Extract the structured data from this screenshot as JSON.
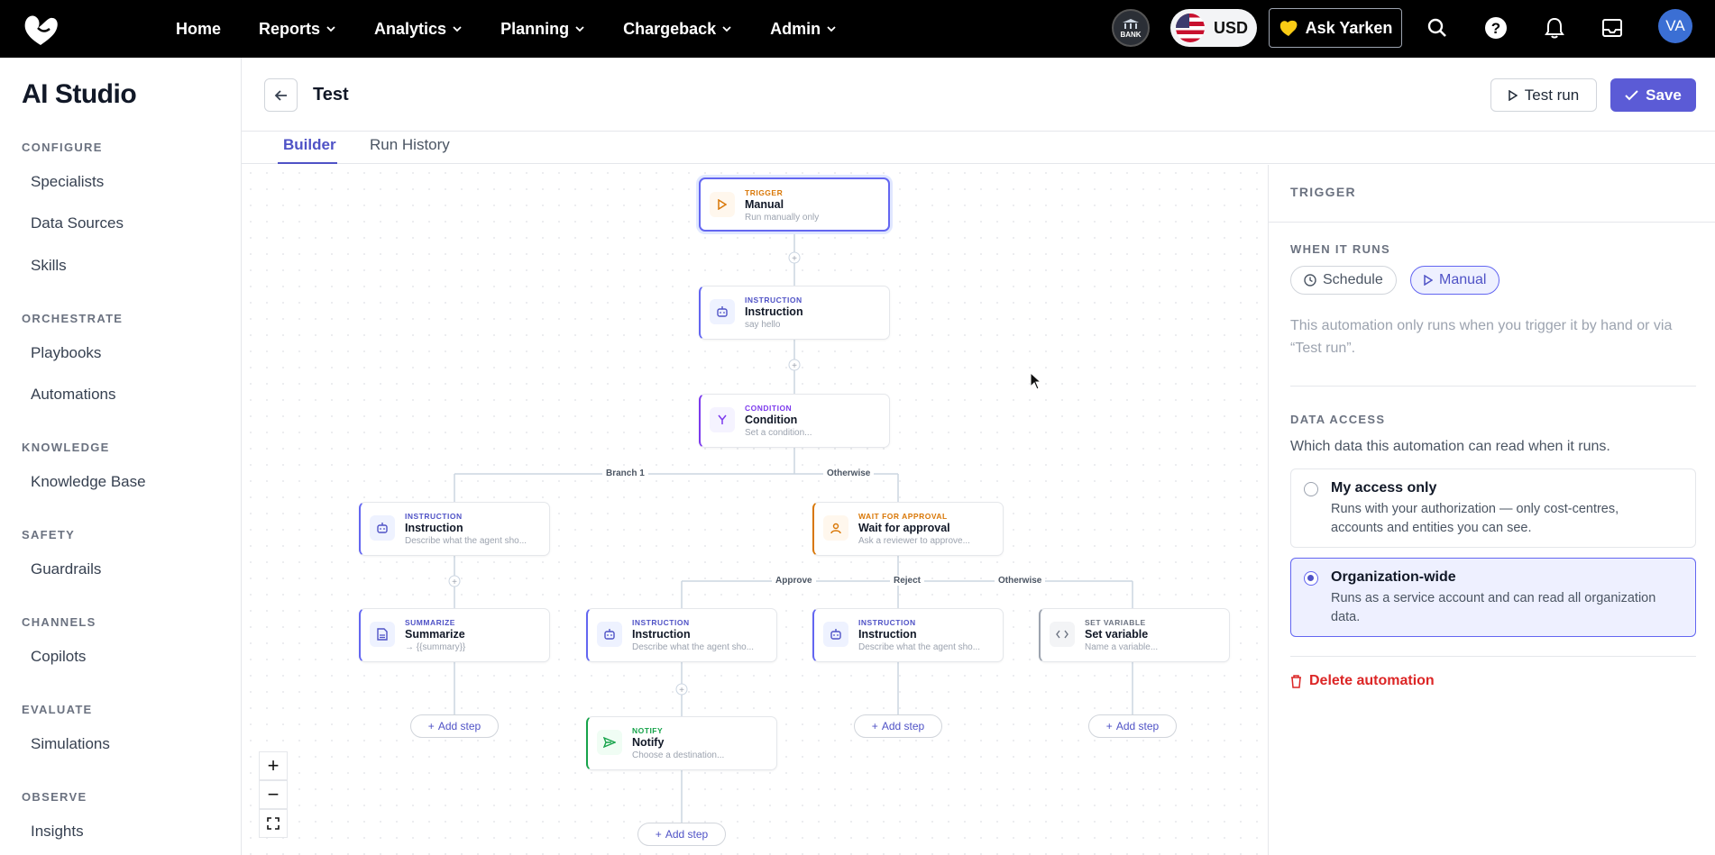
{
  "topbar": {
    "nav": [
      "Home",
      "Reports",
      "Analytics",
      "Planning",
      "Chargeback",
      "Admin"
    ],
    "bank_label": "BANK",
    "currency": "USD",
    "ask_label": "Ask Yarken",
    "avatar_initials": "VA"
  },
  "sidebar": {
    "title": "AI Studio",
    "sections": [
      {
        "label": "CONFIGURE",
        "items": [
          "Specialists",
          "Data Sources",
          "Skills"
        ]
      },
      {
        "label": "ORCHESTRATE",
        "items": [
          "Playbooks",
          "Automations"
        ]
      },
      {
        "label": "KNOWLEDGE",
        "items": [
          "Knowledge Base"
        ]
      },
      {
        "label": "SAFETY",
        "items": [
          "Guardrails"
        ]
      },
      {
        "label": "CHANNELS",
        "items": [
          "Copilots"
        ]
      },
      {
        "label": "EVALUATE",
        "items": [
          "Simulations"
        ]
      },
      {
        "label": "OBSERVE",
        "items": [
          "Insights"
        ]
      }
    ]
  },
  "header": {
    "title": "Test",
    "test_run_label": "Test run",
    "save_label": "Save"
  },
  "tabs": {
    "builder": "Builder",
    "run_history": "Run History"
  },
  "flow": {
    "nodes": {
      "trigger": {
        "type": "TRIGGER",
        "name": "Manual",
        "desc": "Run manually only"
      },
      "instruction1": {
        "type": "INSTRUCTION",
        "name": "Instruction",
        "desc": "say hello"
      },
      "condition": {
        "type": "CONDITION",
        "name": "Condition",
        "desc": "Set a condition..."
      },
      "instruction2": {
        "type": "INSTRUCTION",
        "name": "Instruction",
        "desc": "Describe what the agent sho..."
      },
      "wait": {
        "type": "WAIT FOR APPROVAL",
        "name": "Wait for approval",
        "desc": "Ask a reviewer to approve..."
      },
      "summarize": {
        "type": "SUMMARIZE",
        "name": "Summarize",
        "desc": "→ {{summary}}"
      },
      "instruction3": {
        "type": "INSTRUCTION",
        "name": "Instruction",
        "desc": "Describe what the agent sho..."
      },
      "instruction4": {
        "type": "INSTRUCTION",
        "name": "Instruction",
        "desc": "Describe what the agent sho..."
      },
      "setvar": {
        "type": "SET VARIABLE",
        "name": "Set variable",
        "desc": "Name a variable..."
      },
      "notify": {
        "type": "NOTIFY",
        "name": "Notify",
        "desc": "Choose a destination..."
      }
    },
    "branch_labels": {
      "branch1": "Branch 1",
      "otherwise1": "Otherwise",
      "approve": "Approve",
      "reject": "Reject",
      "otherwise2": "Otherwise"
    },
    "add_step_label": "Add step",
    "colors": {
      "trigger": "#d97706",
      "instruction": "#4f52c6",
      "condition": "#7c3aed",
      "wait": "#d97706",
      "setvar": "#6b7280",
      "notify": "#16a34a"
    }
  },
  "panel": {
    "heading": "TRIGGER",
    "when_label": "WHEN IT RUNS",
    "schedule_label": "Schedule",
    "manual_label": "Manual",
    "trigger_desc": "This automation only runs when you trigger it by hand or via “Test run”.",
    "data_access_label": "DATA ACCESS",
    "data_access_desc": "Which data this automation can read when it runs.",
    "option_mine_title": "My access only",
    "option_mine_desc": "Runs with your authorization — only cost-centres, accounts and entities you can see.",
    "option_org_title": "Organization-wide",
    "option_org_desc": "Runs as a service account and can read all organization data.",
    "selected_option": "Organization-wide",
    "delete_label": "Delete automation"
  }
}
